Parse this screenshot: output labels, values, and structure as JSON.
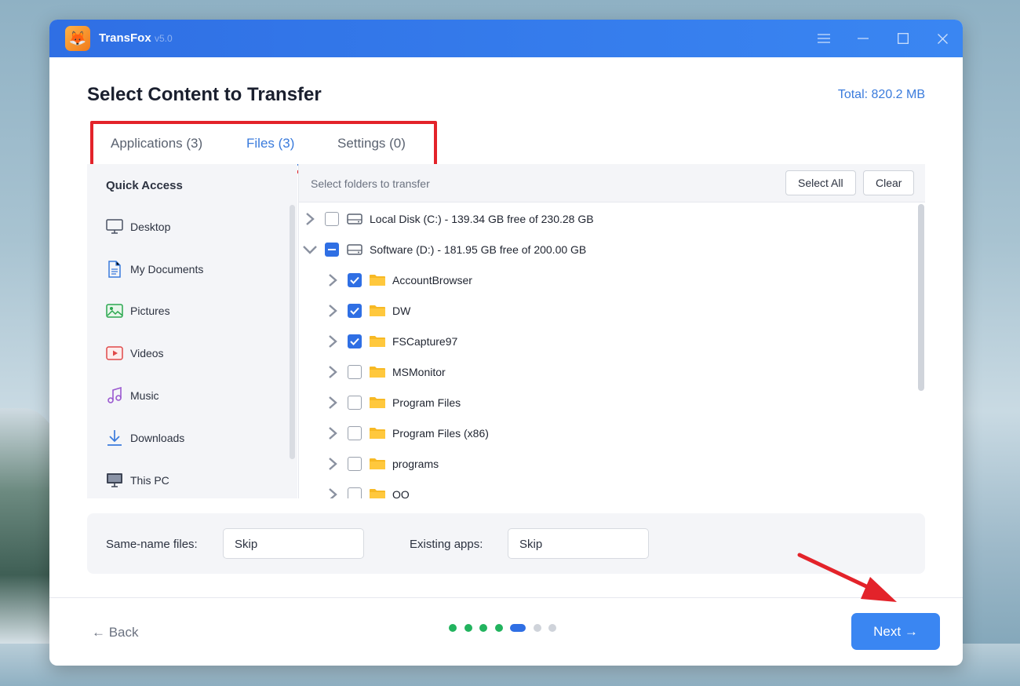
{
  "window": {
    "app_name": "TransFox",
    "version": "v5.0"
  },
  "page": {
    "title": "Select Content to Transfer",
    "total": "Total: 820.2 MB"
  },
  "tabs": [
    {
      "label": "Applications (3)",
      "active": false
    },
    {
      "label": "Files (3)",
      "active": true
    },
    {
      "label": "Settings (0)",
      "active": false
    }
  ],
  "sidebar": {
    "title": "Quick Access",
    "items": [
      {
        "label": "Desktop",
        "icon": "monitor-icon"
      },
      {
        "label": "My Documents",
        "icon": "document-icon"
      },
      {
        "label": "Pictures",
        "icon": "image-icon"
      },
      {
        "label": "Videos",
        "icon": "video-icon"
      },
      {
        "label": "Music",
        "icon": "music-icon"
      },
      {
        "label": "Downloads",
        "icon": "download-icon"
      },
      {
        "label": "This PC",
        "icon": "computer-icon"
      }
    ]
  },
  "tree": {
    "hint": "Select folders to transfer",
    "select_all_label": "Select All",
    "clear_label": "Clear",
    "drives": [
      {
        "name": "Local Disk (C:)",
        "details": " - 139.34 GB free of 230.28 GB",
        "expanded": false,
        "state": "unchecked"
      },
      {
        "name": "Software (D:)",
        "details": " - 181.95 GB free of 200.00 GB",
        "expanded": true,
        "state": "partial"
      }
    ],
    "folders": [
      {
        "name": "AccountBrowser",
        "checked": true
      },
      {
        "name": "DW",
        "checked": true
      },
      {
        "name": "FSCapture97",
        "checked": true
      },
      {
        "name": "MSMonitor",
        "checked": false
      },
      {
        "name": "Program Files",
        "checked": false
      },
      {
        "name": "Program Files (x86)",
        "checked": false
      },
      {
        "name": "programs",
        "checked": false
      },
      {
        "name": "QQ",
        "checked": false
      }
    ]
  },
  "options": {
    "same_name_label": "Same-name files:",
    "same_name_value": "Skip",
    "existing_apps_label": "Existing apps:",
    "existing_apps_value": "Skip"
  },
  "footer": {
    "back_label": "← Back",
    "next_label": "Next →",
    "steps": [
      "done",
      "done",
      "done",
      "done",
      "current",
      "todo",
      "todo"
    ]
  },
  "colors": {
    "accent": "#3a7bdc",
    "titlebar": "#2f6fe4",
    "step_done": "#22b35e",
    "highlight": "#e3232a"
  }
}
